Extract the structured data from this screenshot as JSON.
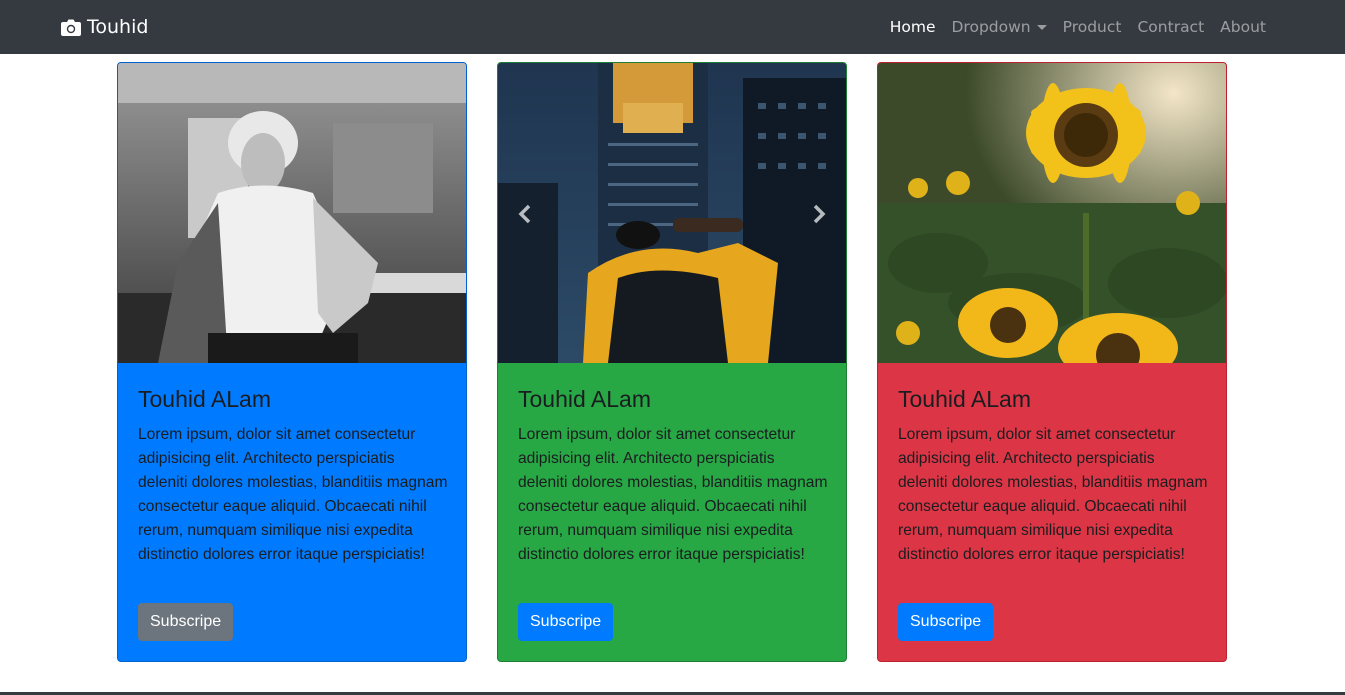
{
  "navbar": {
    "brand": "Touhid",
    "brand_icon": "camera-icon",
    "links": [
      {
        "label": "Home",
        "active": true
      },
      {
        "label": "Dropdown",
        "dropdown": true
      },
      {
        "label": "Product"
      },
      {
        "label": "Contract"
      },
      {
        "label": "About"
      }
    ]
  },
  "cards": [
    {
      "title": "Touhid ALam",
      "text": "Lorem ipsum, dolor sit amet consectetur adipisicing elit. Architecto perspiciatis deleniti dolores molestias, blanditiis magnam consectetur eaque aliquid. Obcaecati nihil rerum, numquam similique nisi expedita distinctio dolores error itaque perspiciatis!",
      "button": "Subscripe",
      "color": "#007bff",
      "button_color": "#6c757d"
    },
    {
      "title": "Touhid ALam",
      "text": "Lorem ipsum, dolor sit amet consectetur adipisicing elit. Architecto perspiciatis deleniti dolores molestias, blanditiis magnam consectetur eaque aliquid. Obcaecati nihil rerum, numquam similique nisi expedita distinctio dolores error itaque perspiciatis!",
      "button": "Subscripe",
      "color": "#28a745",
      "button_color": "#007bff"
    },
    {
      "title": "Touhid ALam",
      "text": "Lorem ipsum, dolor sit amet consectetur adipisicing elit. Architecto perspiciatis deleniti dolores molestias, blanditiis magnam consectetur eaque aliquid. Obcaecati nihil rerum, numquam similique nisi expedita distinctio dolores error itaque perspiciatis!",
      "button": "Subscripe",
      "color": "#dc3545",
      "button_color": "#007bff"
    }
  ]
}
